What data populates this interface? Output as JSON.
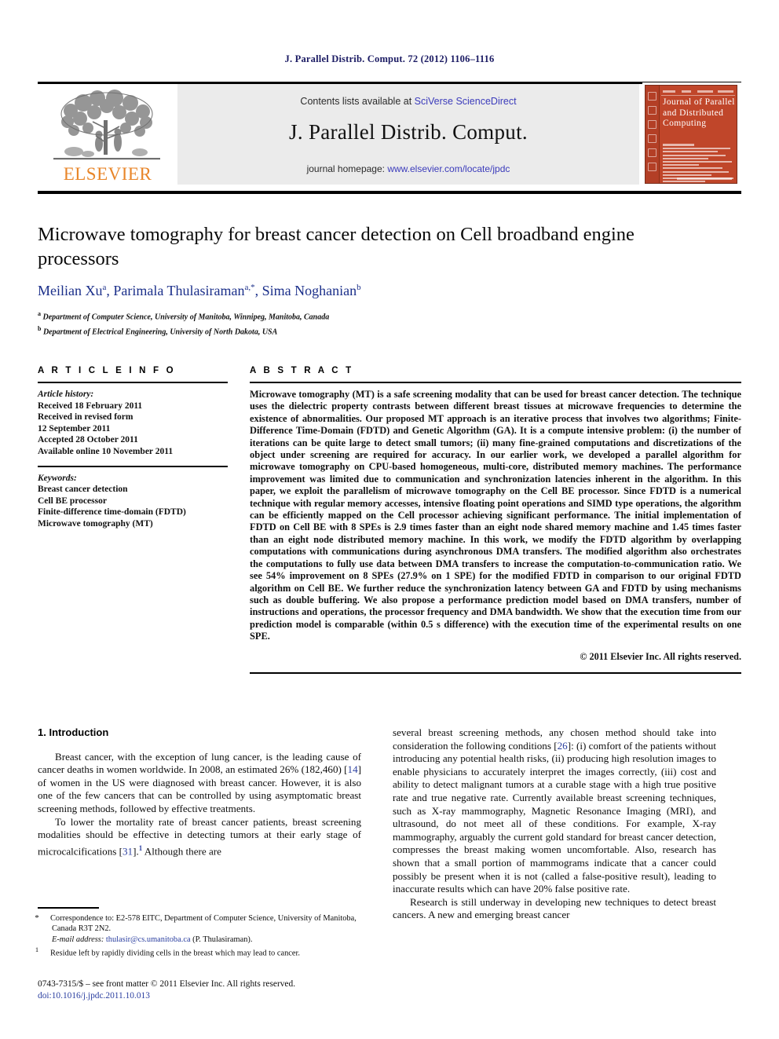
{
  "running_head": "J. Parallel Distrib. Comput. 72 (2012) 1106–1116",
  "masthead": {
    "publisher_name": "ELSEVIER",
    "contents_prefix": "Contents lists available at ",
    "contents_link": "SciVerse ScienceDirect",
    "journal_title": "J. Parallel Distrib. Comput.",
    "homepage_prefix": "journal homepage: ",
    "homepage_url": "www.elsevier.com/locate/jpdc",
    "cover_title": "Journal of Parallel and Distributed Computing"
  },
  "article": {
    "title": "Microwave tomography for breast cancer detection on Cell broadband engine processors",
    "authors_plain": "Meilian Xu a, Parimala Thulasiraman a,*, Sima Noghanian b",
    "affiliation_a": "Department of Computer Science, University of Manitoba, Winnipeg, Manitoba, Canada",
    "affiliation_b": "Department of Electrical Engineering, University of North Dakota, USA"
  },
  "article_info": {
    "heading": "A R T I C L E   I N F O",
    "history_label": "Article history:",
    "history": [
      "Received 18 February 2011",
      "Received in revised form",
      "12 September 2011",
      "Accepted 28 October 2011",
      "Available online 10 November 2011"
    ],
    "keywords_label": "Keywords:",
    "keywords": [
      "Breast cancer detection",
      "Cell BE processor",
      "Finite-difference time-domain (FDTD)",
      "Microwave tomography (MT)"
    ]
  },
  "abstract": {
    "heading": "A B S T R A C T",
    "text": "Microwave tomography (MT) is a safe screening modality that can be used for breast cancer detection. The technique uses the dielectric property contrasts between different breast tissues at microwave frequencies to determine the existence of abnormalities. Our proposed MT approach is an iterative process that involves two algorithms; Finite-Difference Time-Domain (FDTD) and Genetic Algorithm (GA). It is a compute intensive problem: (i) the number of iterations can be quite large to detect small tumors; (ii) many fine-grained computations and discretizations of the object under screening are required for accuracy. In our earlier work, we developed a parallel algorithm for microwave tomography on CPU-based homogeneous, multi-core, distributed memory machines. The performance improvement was limited due to communication and synchronization latencies inherent in the algorithm. In this paper, we exploit the parallelism of microwave tomography on the Cell BE processor. Since FDTD is a numerical technique with regular memory accesses, intensive floating point operations and SIMD type operations, the algorithm can be efficiently mapped on the Cell processor achieving significant performance. The initial implementation of FDTD on Cell BE with 8 SPEs is 2.9 times faster than an eight node shared memory machine and 1.45 times faster than an eight node distributed memory machine. In this work, we modify the FDTD algorithm by overlapping computations with communications during asynchronous DMA transfers. The modified algorithm also orchestrates the computations to fully use data between DMA transfers to increase the computation-to-communication ratio. We see 54% improvement on 8 SPEs (27.9% on 1 SPE) for the modified FDTD in comparison to our original FDTD algorithm on Cell BE. We further reduce the synchronization latency between GA and FDTD by using mechanisms such as double buffering. We also propose a performance prediction model based on DMA transfers, number of instructions and operations, the processor frequency and DMA bandwidth. We show that the execution time from our prediction model is comparable (within 0.5 s difference) with the execution time of the experimental results on one SPE.",
    "copyright": "© 2011 Elsevier Inc. All rights reserved."
  },
  "introduction": {
    "heading": "1. Introduction",
    "left_p1_a": "Breast cancer, with the exception of lung cancer, is the leading cause of cancer deaths in women worldwide. In 2008, an estimated 26% (182,460) [",
    "left_p1_ref": "14",
    "left_p1_b": "] of women in the US were diagnosed with breast cancer. However, it is also one of the few cancers that can be controlled by using asymptomatic breast screening methods, followed by effective treatments.",
    "left_p2_a": "To lower the mortality rate of breast cancer patients, breast screening modalities should be effective in detecting tumors at their early stage of microcalcifications [",
    "left_p2_ref": "31",
    "left_p2_b": "].",
    "left_p2_fn": "1",
    "left_p2_c": " Although there are",
    "right_p1_a": "several breast screening methods, any chosen method should take into consideration the following conditions [",
    "right_p1_ref": "26",
    "right_p1_b": "]: (i) comfort of the patients without introducing any potential health risks, (ii) producing high resolution images to enable physicians to accurately interpret the images correctly, (iii) cost and ability to detect malignant tumors at a curable stage with a high true positive rate and true negative rate. Currently available breast screening techniques, such as X-ray mammography, Magnetic Resonance Imaging (MRI), and ultrasound, do not meet all of these conditions. For example, X-ray mammography, arguably the current gold standard for breast cancer detection, compresses the breast making women uncomfortable. Also, research has shown that a small portion of mammograms indicate that a cancer could possibly be present when it is not (called a false-positive result), leading to inaccurate results which can have 20% false positive rate.",
    "right_p2": "Research is still underway in developing new techniques to detect breast cancers. A new and emerging breast cancer"
  },
  "footnotes": {
    "corr_marker": "*",
    "corr_text": "Correspondence to: E2-578 EITC, Department of Computer Science, University of Manitoba, Canada R3T 2N2.",
    "email_label": "E-mail address:",
    "email": "thulasir@cs.umanitoba.ca",
    "email_suffix": "(P. Thulasiraman).",
    "fn1_marker": "1",
    "fn1_text": "Residue left by rapidly dividing cells in the breast which may lead to cancer."
  },
  "imprint": {
    "line1": "0743-7315/$ – see front matter © 2011 Elsevier Inc. All rights reserved.",
    "doi_prefix": "doi:",
    "doi": "10.1016/j.jpdc.2011.10.013"
  },
  "colors": {
    "accent_blue": "#2b3fa0",
    "title_blue": "#1b2f8a",
    "elsevier_orange": "#e8862a",
    "cover_red": "#c0462a",
    "masthead_grey": "#ebebeb"
  }
}
